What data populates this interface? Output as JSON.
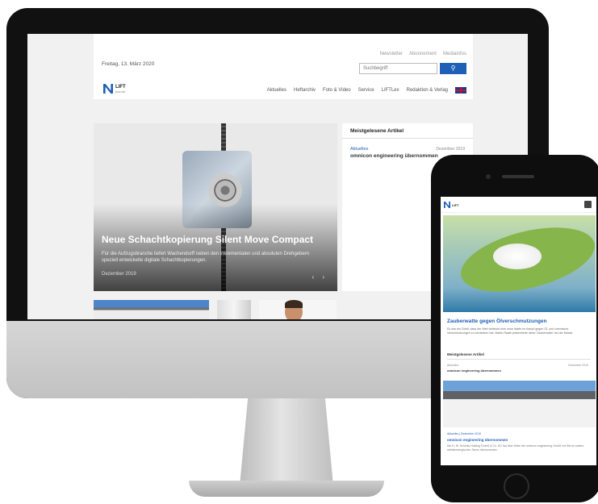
{
  "desktop": {
    "date": "Freitag, 13. März 2020",
    "top_links": [
      "Newsletter",
      "Abonnement",
      "Mediainfos"
    ],
    "search_placeholder": "Suchbegriff",
    "logo": {
      "line1": "LIFT",
      "line2": "journal"
    },
    "nav": [
      "Aktuelles",
      "Heftarchiv",
      "Foto & Video",
      "Service",
      "LIFTLex",
      "Redaktion & Verlag"
    ],
    "hero": {
      "title": "Neue Schachtkopierung Silent Move Compact",
      "text": "Für die Aufzugsbranche liefert Wachendorff neben den inkrementalen und absoluten Drehgebern speziell entwickelte digitale Schachtkopierungen.",
      "date": "Dezember 2019",
      "arrows": "‹ ›"
    },
    "popular": {
      "heading": "Meistgelesene Artikel",
      "category": "Aktuelles",
      "date": "Dezember 2019",
      "title": "omnicon engineering übernommen"
    }
  },
  "mobile": {
    "logo": {
      "line1": "LIFT",
      "line2": "journal"
    },
    "headline": "Zauberwatte gegen Ölverschmutzungen",
    "teaser": "Es war ein Zufall, dass der Welt vielleicht eine neue Waffe im Kampf gegen Öl- und chemische Verschmutzungen zu verdanken hat. Martin Raath präsentierte diese 'Zauberwatte' bei der Messe.",
    "popular_heading": "Meistgelesene Artikel",
    "popular_category": "Aktuelles",
    "popular_date": "Dezember 2019",
    "popular_title": "omnicon engineering übernommen",
    "article_meta": "Aktuelles | Dezember 2019",
    "article_title": "omnicon engineering übernommen",
    "article_text": "Die H. W. Schmitz Holding GmbH & Co. KG hat über Dritte die omnicon engineering GmbH mit Sitz im baden-württembergischen Tamm übernommen."
  },
  "colors": {
    "accent": "#1f5fb6"
  }
}
